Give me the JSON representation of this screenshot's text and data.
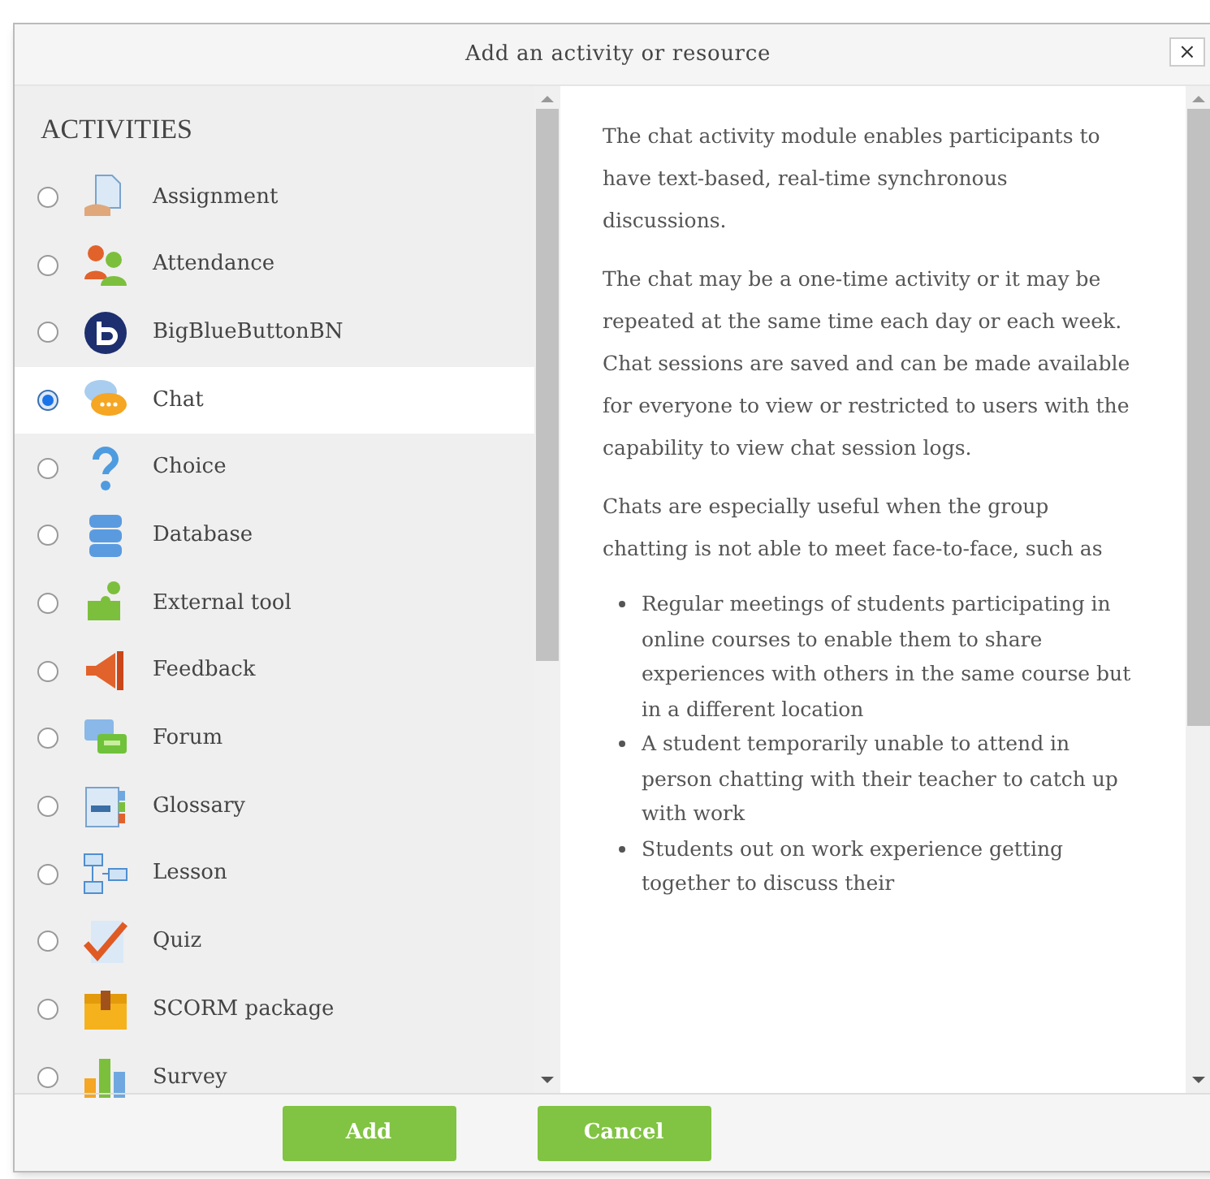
{
  "dialog": {
    "title": "Add an activity or resource",
    "close": "×"
  },
  "activities": {
    "heading": "ACTIVITIES",
    "items": [
      {
        "label": "Assignment",
        "selected": false
      },
      {
        "label": "Attendance",
        "selected": false
      },
      {
        "label": "BigBlueButtonBN",
        "selected": false
      },
      {
        "label": "Chat",
        "selected": true
      },
      {
        "label": "Choice",
        "selected": false
      },
      {
        "label": "Database",
        "selected": false
      },
      {
        "label": "External tool",
        "selected": false
      },
      {
        "label": "Feedback",
        "selected": false
      },
      {
        "label": "Forum",
        "selected": false
      },
      {
        "label": "Glossary",
        "selected": false
      },
      {
        "label": "Lesson",
        "selected": false
      },
      {
        "label": "Quiz",
        "selected": false
      },
      {
        "label": "SCORM package",
        "selected": false
      },
      {
        "label": "Survey",
        "selected": false
      }
    ]
  },
  "description": {
    "paragraphs": [
      "The chat activity module enables participants to have text-based, real-time synchronous discussions.",
      "The chat may be a one-time activity or it may be repeated at the same time each day or each week. Chat sessions are saved and can be made available for everyone to view or restricted to users with the capability to view chat session logs.",
      "Chats are especially useful when the group chatting is not able to meet face-to-face, such as"
    ],
    "bullets": [
      "Regular meetings of students participating in online courses to enable them to share experiences with others in the same course but in a different location",
      "A student temporarily unable to attend in person chatting with their teacher to catch up with work",
      "Students out on work experience getting together to discuss their"
    ]
  },
  "buttons": [
    "Add",
    "Cancel"
  ]
}
